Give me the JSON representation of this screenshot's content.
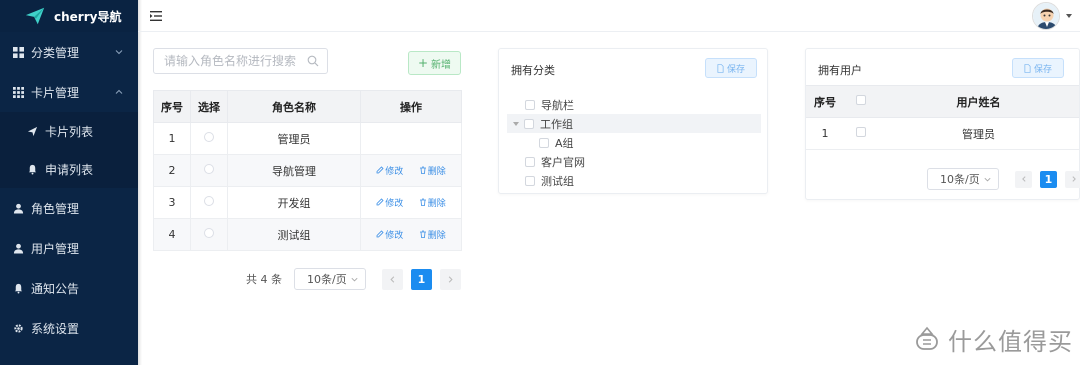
{
  "brand": {
    "name": "cherry导航"
  },
  "sidebar": {
    "items": [
      {
        "label": "分类管理",
        "icon": "grid-icon",
        "expanded": false
      },
      {
        "label": "卡片管理",
        "icon": "apps-icon",
        "expanded": true
      },
      {
        "label": "卡片列表",
        "icon": "send-icon",
        "sub": true
      },
      {
        "label": "申请列表",
        "icon": "bell-icon",
        "sub": true
      },
      {
        "label": "角色管理",
        "icon": "user-icon"
      },
      {
        "label": "用户管理",
        "icon": "user-icon"
      },
      {
        "label": "通知公告",
        "icon": "bell-icon"
      },
      {
        "label": "系统设置",
        "icon": "gear-icon"
      }
    ]
  },
  "roles": {
    "search_placeholder": "请输入角色名称进行搜索",
    "add_label": "新增",
    "columns": [
      "序号",
      "选择",
      "角色名称",
      "操作"
    ],
    "rows": [
      {
        "index": "1",
        "name": "管理员"
      },
      {
        "index": "2",
        "name": "导航管理",
        "edit": "修改",
        "delete": "删除"
      },
      {
        "index": "3",
        "name": "开发组",
        "edit": "修改",
        "delete": "删除"
      },
      {
        "index": "4",
        "name": "测试组",
        "edit": "修改",
        "delete": "删除"
      }
    ],
    "pager": {
      "total": "共 4 条",
      "size": "10条/页",
      "page": "1"
    }
  },
  "categories": {
    "title": "拥有分类",
    "save_label": "保存",
    "tree": [
      {
        "label": "导航栏",
        "level": 0
      },
      {
        "label": "工作组",
        "level": 0,
        "expanded": true
      },
      {
        "label": "A组",
        "level": 1
      },
      {
        "label": "客户官网",
        "level": 0
      },
      {
        "label": "测试组",
        "level": 0
      }
    ]
  },
  "users": {
    "title": "拥有用户",
    "save_label": "保存",
    "columns": [
      "序号",
      "",
      "用户姓名"
    ],
    "rows": [
      {
        "index": "1",
        "name": "管理员"
      }
    ],
    "pager": {
      "size": "10条/页",
      "page": "1"
    }
  },
  "watermark": {
    "text": "什么值得买"
  },
  "colors": {
    "sidebar": "#0b2545",
    "primary": "#1b8cf0",
    "success": "#52b06d"
  }
}
